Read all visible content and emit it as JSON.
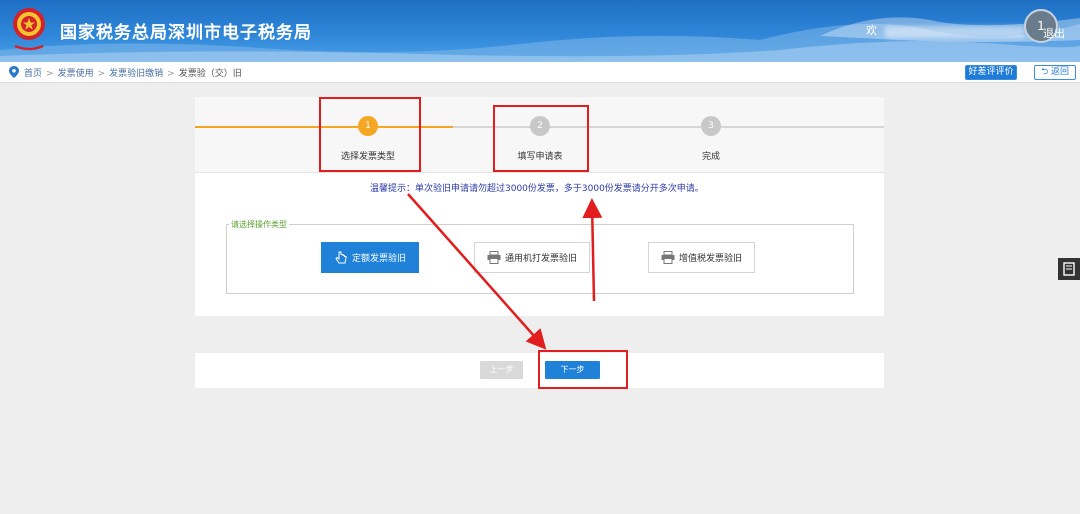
{
  "header": {
    "title": "国家税务总局深圳市电子税务局",
    "user_greeting": "欢",
    "avatar_text": "1",
    "logout_label": "退出"
  },
  "breadcrumb": {
    "items": [
      "首页",
      "发票使用",
      "发票验旧缴销",
      "发票验（交）旧"
    ],
    "rate_label": "好差评评价",
    "back_label": "返回"
  },
  "steps": [
    {
      "number": "1",
      "label": "选择发票类型",
      "state": "active"
    },
    {
      "number": "2",
      "label": "填写申请表",
      "state": "pending"
    },
    {
      "number": "3",
      "label": "完成",
      "state": "pending"
    }
  ],
  "tip": "温馨提示：单次验旧申请请勿超过3000份发票，多于3000份发票请分开多次申请。",
  "operation_group": {
    "legend": "请选择操作类型",
    "options": [
      {
        "label": "定额发票验旧",
        "icon": "hand-pointer-icon",
        "selected": true
      },
      {
        "label": "通用机打发票验旧",
        "icon": "printer-icon",
        "selected": false
      },
      {
        "label": "增值税发票验旧",
        "icon": "printer-icon",
        "selected": false
      }
    ]
  },
  "nav": {
    "prev_label": "上一步",
    "next_label": "下一步"
  },
  "colors": {
    "header_blue": "#1e6fc4",
    "primary_blue": "#1f82d8",
    "step_active": "#f5a623",
    "step_pending": "#c8c8c8",
    "annotation_red": "#e11d1d",
    "tip_text": "#2a3aaa"
  }
}
